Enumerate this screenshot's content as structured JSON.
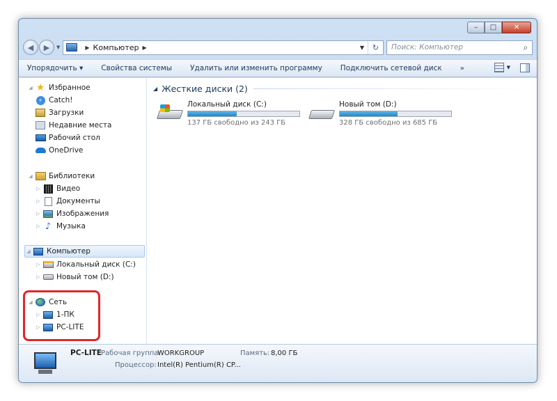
{
  "window": {
    "controls": {
      "minimize": "–",
      "maximize": "□",
      "close": "✕"
    }
  },
  "nav": {
    "back_icon": "◀",
    "forward_icon": "▶",
    "address_sep": "▶",
    "address_path": "Компьютер",
    "address_dropdown": "▼",
    "refresh_icon": "↻",
    "search_placeholder": "Поиск: Компьютер",
    "search_icon": "⌕"
  },
  "toolbar": {
    "organize": "Упорядочить ▾",
    "system_properties": "Свойства системы",
    "uninstall": "Удалить или изменить программу",
    "map_drive": "Подключить сетевой диск",
    "more": "»"
  },
  "sidebar": {
    "favorites": {
      "label": "Избранное",
      "items": [
        "Catch!",
        "Загрузки",
        "Недавние места",
        "Рабочий стол",
        "OneDrive"
      ]
    },
    "libraries": {
      "label": "Библиотеки",
      "items": [
        "Видео",
        "Документы",
        "Изображения",
        "Музыка"
      ]
    },
    "computer": {
      "label": "Компьютер",
      "items": [
        "Локальный диск (C:)",
        "Новый том (D:)"
      ]
    },
    "network": {
      "label": "Сеть",
      "items": [
        "1-ПК",
        "PC-LITE"
      ]
    }
  },
  "main": {
    "group_title": "Жесткие диски (2)",
    "disks": [
      {
        "name": "Локальный диск (C:)",
        "free_text": "137 ГБ свободно из 243 ГБ",
        "used_fraction": 0.436
      },
      {
        "name": "Новый том (D:)",
        "free_text": "328 ГБ свободно из 685 ГБ",
        "used_fraction": 0.521
      }
    ]
  },
  "details": {
    "name": "PC-LITE",
    "workgroup_label": "Рабочая группа:",
    "workgroup_value": "WORKGROUP",
    "memory_label": "Память:",
    "memory_value": "8,00 ГБ",
    "processor_label": "Процессор:",
    "processor_value": "Intel(R) Pentium(R) CP..."
  },
  "colors": {
    "accent": "#1f88c8",
    "highlight": "#e0262a",
    "group_title": "#1e3b63"
  }
}
